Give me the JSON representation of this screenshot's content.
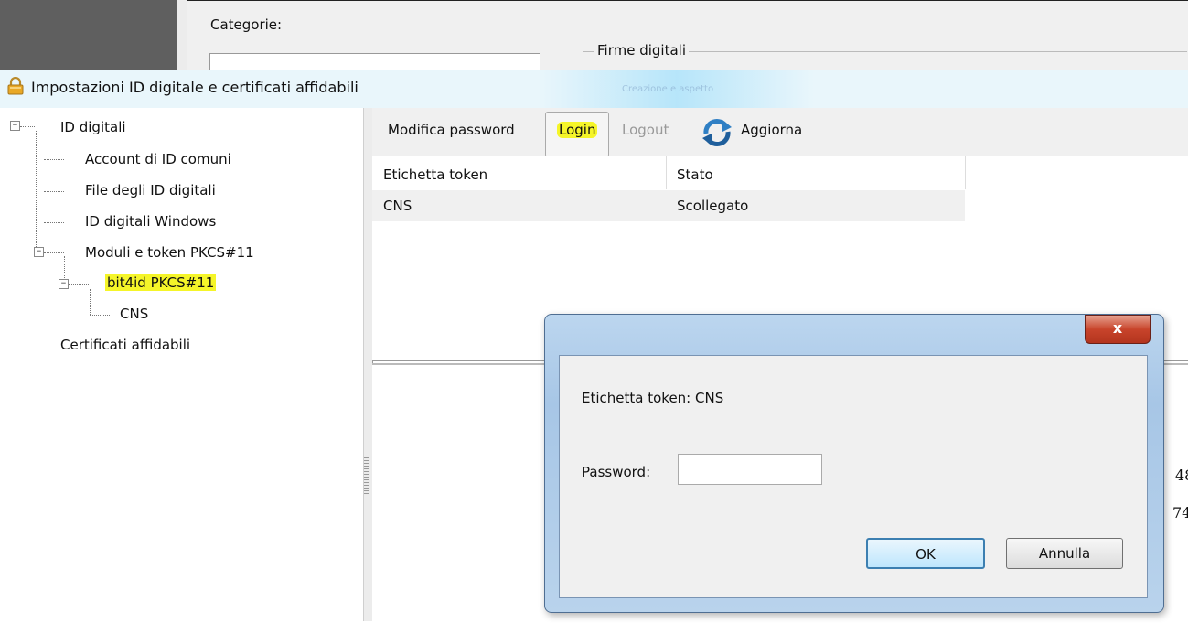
{
  "background_window": {
    "categories_label": "Categorie:",
    "group_title": "Firme digitali"
  },
  "dialog": {
    "title": "Impostazioni ID digitale e certificati affidabili",
    "blurred_text": "Creazione e aspetto"
  },
  "tree": {
    "items": [
      {
        "label": "ID digitali"
      },
      {
        "label": "Account di ID comuni"
      },
      {
        "label": "File degli ID digitali"
      },
      {
        "label": "ID digitali Windows"
      },
      {
        "label": "Moduli e token PKCS#11"
      },
      {
        "label": "bit4id PKCS#11"
      },
      {
        "label": "CNS"
      },
      {
        "label": "Certificati affidabili"
      }
    ]
  },
  "toolbar": {
    "modifica_label": "Modifica password",
    "login_label": "Login",
    "logout_label": "Logout",
    "aggiorna_label": "Aggiorna"
  },
  "table": {
    "headers": [
      "Etichetta token",
      "Stato"
    ],
    "rows": [
      [
        "CNS",
        "Scollegato"
      ]
    ]
  },
  "detail": {
    "partial_1": "48",
    "partial_2": "74"
  },
  "modal": {
    "close_glyph": "x",
    "token_text": "Etichetta token: CNS",
    "password_label": "Password:",
    "password_value": "",
    "ok_label": "OK",
    "cancel_label": "Annulla"
  },
  "colors": {
    "highlight": "#f5f529",
    "title_bar": "#e9f6fb",
    "modal_frame": "#a7c6e6",
    "close_button": "#c8442b"
  },
  "icons": [
    "lock-icon",
    "refresh-icon",
    "close-icon"
  ]
}
